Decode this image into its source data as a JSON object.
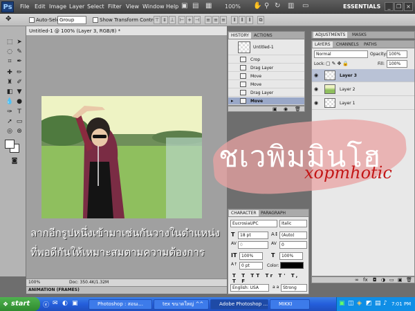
{
  "menu": {
    "logo": "Ps",
    "items": [
      "File",
      "Edit",
      "Image",
      "Layer",
      "Select",
      "Filter",
      "View",
      "Window",
      "Help"
    ],
    "zoom": "100%",
    "workspace": "ESSENTIALS"
  },
  "options": {
    "auto_select": "Auto-Select:",
    "group": "Group",
    "show_transform": "Show Transform Controls"
  },
  "document": {
    "tab": "Untitled-1 @ 100% (Layer 3, RGB/8) *",
    "zoom": "100%",
    "doc_size": "Doc: 350.4K/1.32M",
    "animation": "ANIMATION (FRAMES)"
  },
  "history": {
    "tabs": [
      "HISTORY",
      "ACTIONS"
    ],
    "snapshot": "Untitled-1",
    "rows": [
      "Crop",
      "Drag Layer",
      "Move",
      "Move",
      "Drag Layer",
      "Move"
    ],
    "selected": 5
  },
  "adjust_tabs": [
    "ADJUSTMENTS",
    "MASKS"
  ],
  "layers": {
    "tabs": [
      "LAYERS",
      "CHANNELS",
      "PATHS"
    ],
    "blend": "Normal",
    "opacity_label": "Opacity:",
    "opacity": "100%",
    "lock_label": "Lock:",
    "fill_label": "Fill:",
    "fill": "100%",
    "items": [
      "Layer 3",
      "Layer 2",
      "Layer 1"
    ],
    "selected": 0
  },
  "character": {
    "tabs": [
      "CHARACTER",
      "PARAGRAPH"
    ],
    "font": "EucrosiaUPC",
    "style": "Italic",
    "size": "18 pt",
    "leading": "(Auto)",
    "kerning": "0",
    "tracking": "0",
    "vscale": "100%",
    "hscale": "100%",
    "baseline": "0 pt",
    "color_label": "Color:",
    "language": "English: USA",
    "aa": "Strong",
    "aa_label": "a a",
    "styles": "T T TT Tr T' T, T F"
  },
  "watermark": {
    "thai": "ชเวพิมมินโฮ",
    "latin": "xopmhotic"
  },
  "overlay": {
    "line1": "ลากอีกรูปหนึ่งเข้ามาเช่นกันวางในตำแหน่ง",
    "line2": "ที่พอดีกันให้เหมาะสมตามความต้องการ"
  },
  "taskbar": {
    "start": "start",
    "tasks": [
      "Photoshop : สอนเ...",
      "tex ขนาดใหญ่ ^^",
      "Adobe Photoshop ...",
      "MIKKI"
    ],
    "active": 2,
    "clock": "7:01 PM"
  },
  "colors": {
    "accent": "#245edb",
    "watermark_pink": "#e9a3a3",
    "watermark_red": "#c31616"
  }
}
